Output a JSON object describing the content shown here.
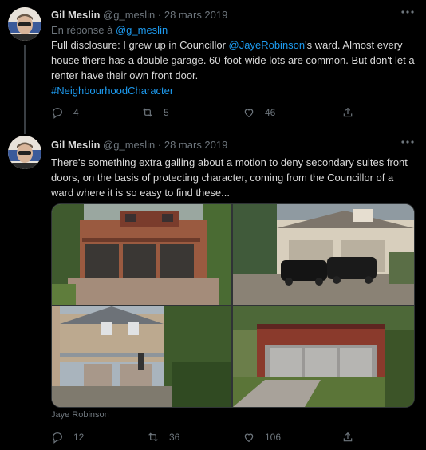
{
  "tweet1": {
    "name": "Gil Meslin",
    "handle": "@g_meslin",
    "dot": "·",
    "date": "28 mars 2019",
    "reply_prefix": "En réponse à",
    "reply_handle": "@g_meslin",
    "text_a": "Full disclosure: I grew up in Councillor ",
    "mention": "@JayeRobinson",
    "text_b": "'s ward. Almost every house there has a double garage. 60-foot-wide lots are common. But don't let a renter have their own front door.",
    "hashtag": "#NeighbourhoodCharacter",
    "replies": "4",
    "retweets": "5",
    "likes": "46"
  },
  "tweet2": {
    "name": "Gil Meslin",
    "handle": "@g_meslin",
    "dot": "·",
    "date": "28 mars 2019",
    "text": "There's something extra galling about a motion to deny secondary suites front doors, on the basis of protecting character, coming from the Councillor of a ward where it is so easy to find these...",
    "image_caption": "Jaye Robinson",
    "replies": "12",
    "retweets": "36",
    "likes": "106"
  },
  "colors": {
    "background": "#000000",
    "link": "#1d9bf0",
    "muted": "#6e767d",
    "text": "#d9d9d9"
  },
  "icons": [
    "reply-icon",
    "retweet-icon",
    "like-icon",
    "share-icon",
    "more-icon"
  ]
}
